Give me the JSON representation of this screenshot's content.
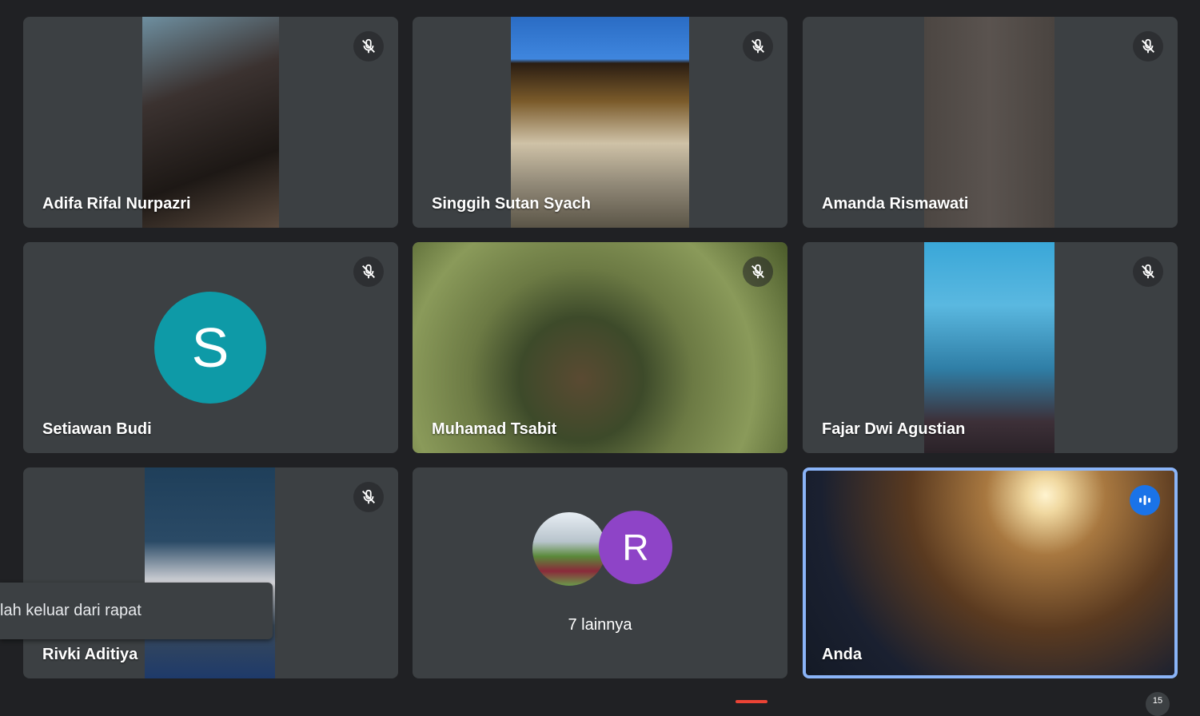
{
  "participants": [
    {
      "name": "Adifa Rifal Nurpazri",
      "muted": true
    },
    {
      "name": "Singgih Sutan Syach",
      "muted": true
    },
    {
      "name": "Amanda Rismawati",
      "muted": true
    },
    {
      "name": "Setiawan Budi",
      "muted": true,
      "avatar_letter": "S"
    },
    {
      "name": "Muhamad Tsabit",
      "muted": true
    },
    {
      "name": "Fajar Dwi Agustian",
      "muted": true
    },
    {
      "name": "Rivki Aditiya",
      "muted": true
    },
    {
      "name": "Anda",
      "speaking": true
    }
  ],
  "others_tile": {
    "avatar_letter": "R",
    "label": "7 lainnya"
  },
  "toast": {
    "text": "lah keluar dari rapat"
  },
  "participant_count": "15",
  "colors": {
    "background": "#202124",
    "tile": "#3c4043",
    "accent": "#1a73e8",
    "avatar_teal": "#0e9aa7",
    "avatar_purple": "#8e44c7"
  }
}
